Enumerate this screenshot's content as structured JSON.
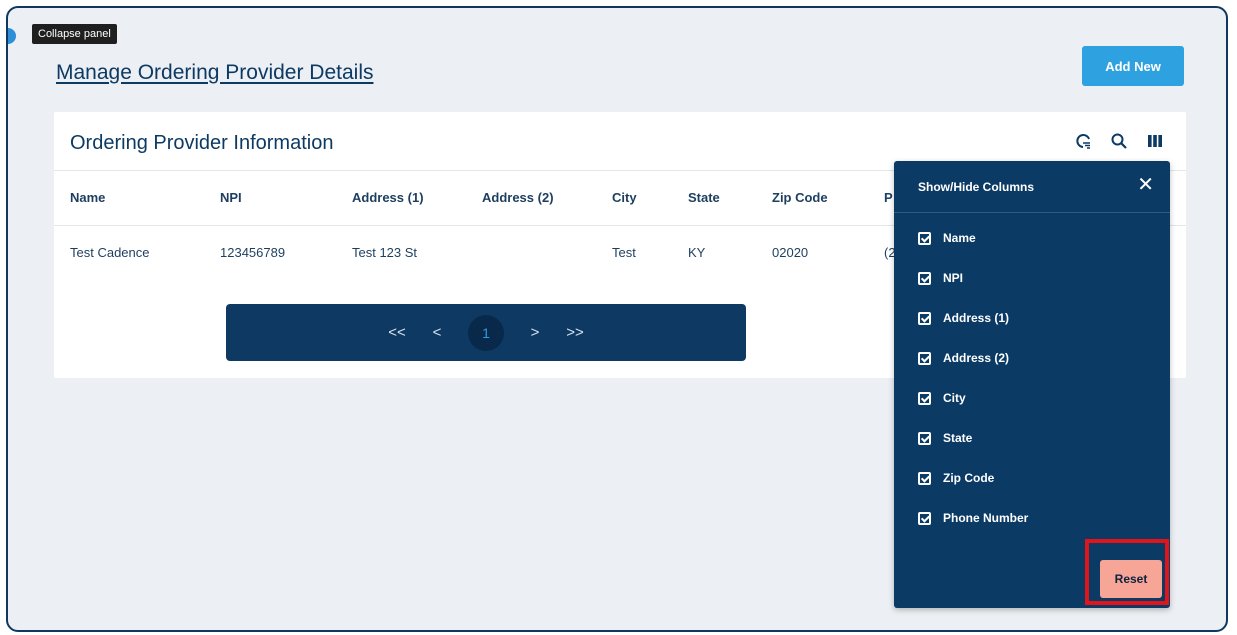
{
  "tooltip": "Collapse panel",
  "page_title": "Manage Ordering Provider Details",
  "add_button": "Add New",
  "card": {
    "title": "Ordering Provider Information",
    "icons": [
      "filter-icon",
      "search-icon",
      "columns-icon"
    ]
  },
  "table": {
    "headers": [
      "Name",
      "NPI",
      "Address (1)",
      "Address (2)",
      "City",
      "State",
      "Zip Code",
      "P"
    ],
    "rows": [
      [
        "Test Cadence",
        "123456789",
        "Test 123 St",
        "",
        "Test",
        "KY",
        "02020",
        "(2"
      ]
    ]
  },
  "pagination": {
    "first": "<<",
    "prev": "<",
    "current": "1",
    "next": ">",
    "last": ">>"
  },
  "column_panel": {
    "title": "Show/Hide Columns",
    "close": "✕",
    "options": [
      {
        "label": "Name",
        "checked": true
      },
      {
        "label": "NPI",
        "checked": true
      },
      {
        "label": "Address (1)",
        "checked": true
      },
      {
        "label": "Address (2)",
        "checked": true
      },
      {
        "label": "City",
        "checked": true
      },
      {
        "label": "State",
        "checked": true
      },
      {
        "label": "Zip Code",
        "checked": true
      },
      {
        "label": "Phone Number",
        "checked": true
      }
    ],
    "reset": "Reset"
  },
  "colors": {
    "navy": "#0b3a65",
    "accent_blue": "#2ea1e0",
    "reset_bg": "#f6a596",
    "highlight_red": "#e1141c"
  }
}
